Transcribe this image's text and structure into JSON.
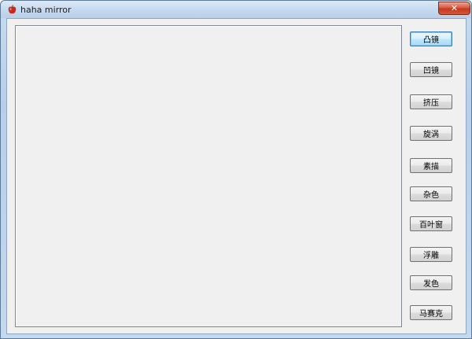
{
  "window": {
    "title": "haha mirror",
    "icon": "red-apple-icon",
    "close_glyph": "✕"
  },
  "effects": [
    {
      "label": "凸镜"
    },
    {
      "label": "凹镜"
    },
    {
      "label": "挤压"
    },
    {
      "label": "旋涡"
    },
    {
      "label": "素描"
    },
    {
      "label": "杂色"
    },
    {
      "label": "百叶窗"
    },
    {
      "label": "浮雕"
    },
    {
      "label": "发色"
    },
    {
      "label": "马赛克"
    }
  ],
  "colors": {
    "titlebar": "#c7daef",
    "client_bg": "#f0f0f0",
    "close_button": "#c7381c",
    "default_button_border": "#3c7fb1"
  }
}
